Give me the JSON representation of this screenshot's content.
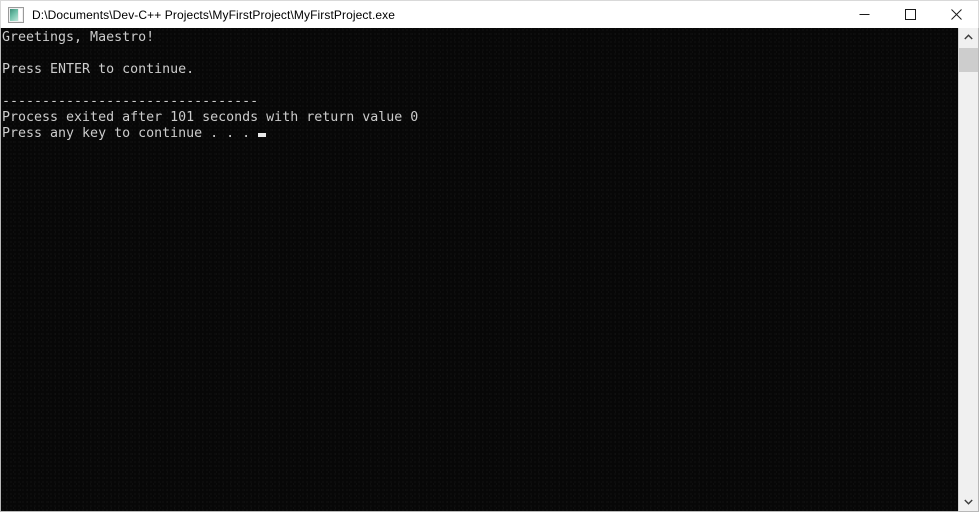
{
  "window": {
    "title": "D:\\Documents\\Dev-C++ Projects\\MyFirstProject\\MyFirstProject.exe",
    "icon": "console-app-icon",
    "titlebar_bg": "#ffffff",
    "title_color": "#000000"
  },
  "controls": {
    "minimize": {
      "name": "minimize-button",
      "glyph": "—"
    },
    "maximize": {
      "name": "maximize-button",
      "glyph": "□"
    },
    "close": {
      "name": "close-button",
      "glyph": "✕"
    }
  },
  "console": {
    "background": "#0c0c0c",
    "foreground": "#cccccc",
    "lines": [
      "Greetings, Maestro!",
      "",
      "Press ENTER to continue.",
      "",
      "--------------------------------",
      "Process exited after 101 seconds with return value 0",
      "Press any key to continue . . . "
    ],
    "cursor_visible": true,
    "cursor_line_index": 6
  },
  "scrollbar": {
    "up_arrow": "˄",
    "down_arrow": "˅",
    "thumb_position_percent": 0,
    "thumb_size_percent": 5
  }
}
